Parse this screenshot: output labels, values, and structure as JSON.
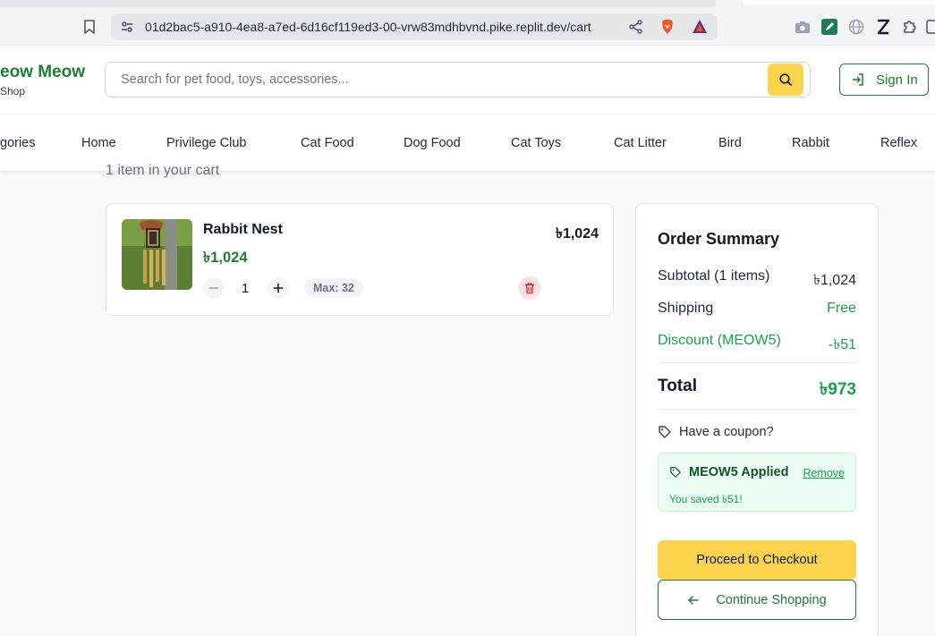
{
  "browser": {
    "url": "01d2bac5-a910-4ea8-a7ed-6d16cf119ed3-00-vrw83mdhbvnd.pike.replit.dev/cart"
  },
  "header": {
    "logo_name": "eow Meow",
    "logo_sub": "Shop",
    "search_placeholder": "Search for pet food, toys, accessories...",
    "sign_in_label": "Sign In"
  },
  "nav": {
    "items": [
      "gories",
      "Home",
      "Privilege Club",
      "Cat Food",
      "Dog Food",
      "Cat Toys",
      "Cat Litter",
      "Bird",
      "Rabbit",
      "Reflex"
    ]
  },
  "cart": {
    "count_text": "1 item in your cart",
    "item": {
      "name": "Rabbit Nest",
      "unit_price": "৳1,024",
      "line_total": "৳1,024",
      "quantity": "1",
      "max_label": "Max: 32"
    }
  },
  "summary": {
    "title": "Order Summary",
    "subtotal_label": "Subtotal (1 items)",
    "subtotal_value": "৳1,024",
    "shipping_label": "Shipping",
    "shipping_value": "Free",
    "discount_label": "Discount (MEOW5)",
    "discount_value": "-৳51",
    "total_label": "Total",
    "total_value": "৳973",
    "coupon_question": "Have a coupon?",
    "applied_title": "MEOW5 Applied",
    "remove_label": "Remove",
    "saved_text": "You saved ৳51!",
    "checkout_label": "Proceed to Checkout",
    "continue_label": "Continue Shopping"
  },
  "colors": {
    "brand_green": "#1e7e34",
    "accent_yellow": "#fcd34d",
    "success_green": "#16a34a"
  }
}
